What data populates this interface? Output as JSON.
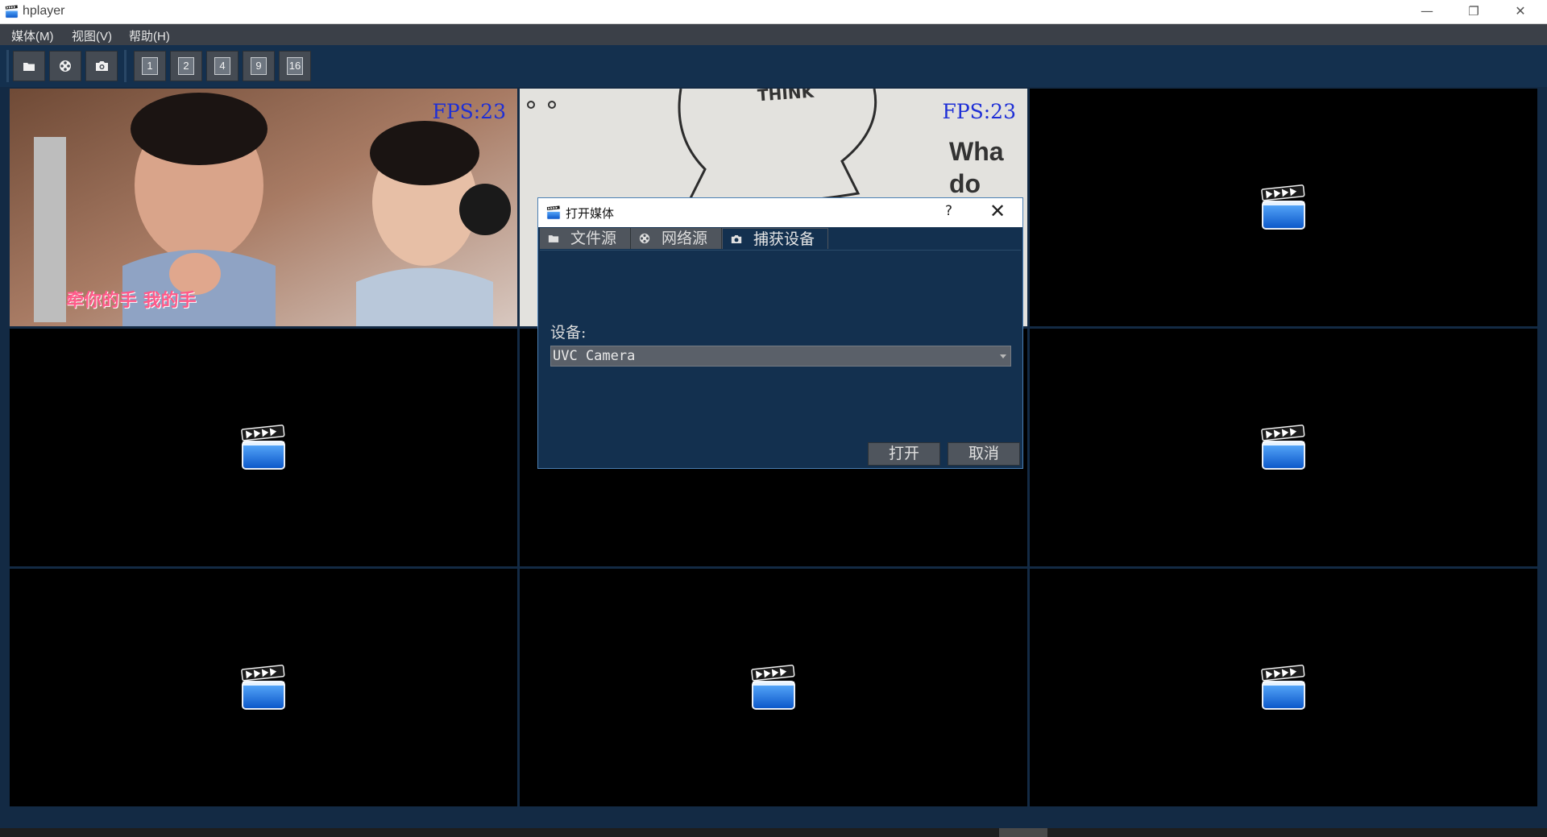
{
  "window": {
    "title": "hplayer",
    "minimize": "—",
    "restore": "❐",
    "close": "✕"
  },
  "menu": [
    {
      "label": "媒体(M)"
    },
    {
      "label": "视图(V)"
    },
    {
      "label": "帮助(H)"
    }
  ],
  "toolbar": {
    "buttons": [
      {
        "icon": "folder-icon"
      },
      {
        "icon": "film-reel-icon"
      },
      {
        "icon": "camera-icon"
      }
    ],
    "layouts": [
      "1",
      "2",
      "4",
      "9",
      "16"
    ]
  },
  "grid": {
    "cells": [
      {
        "fps": "FPS:23",
        "video": true,
        "subtitle": "牵你的手 我的手"
      },
      {
        "fps": "FPS:23",
        "video": true,
        "board_text": "Wha do",
        "label_text": "THINK"
      },
      {
        "video": false
      },
      {
        "video": false
      },
      {
        "video": false
      },
      {
        "video": false
      },
      {
        "video": false
      },
      {
        "video": false
      },
      {
        "video": false
      }
    ]
  },
  "dialog": {
    "title": "打开媒体",
    "help": "?",
    "close": "✕",
    "tabs": [
      {
        "label": "文件源",
        "icon": "folder-icon"
      },
      {
        "label": "网络源",
        "icon": "film-reel-icon"
      },
      {
        "label": "捕获设备",
        "icon": "camera-icon",
        "active": true
      }
    ],
    "device_label": "设备:",
    "device_value": "UVC Camera",
    "open_button": "打开",
    "cancel_button": "取消"
  },
  "colors": {
    "background": "#132a44",
    "fps_text": "#1e2fd6",
    "icon_blue": "#1f7ae0"
  }
}
